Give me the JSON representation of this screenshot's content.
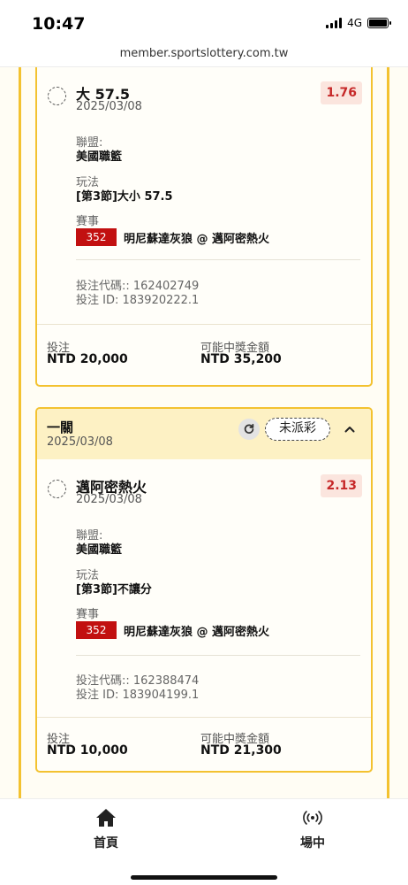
{
  "status_bar": {
    "time": "10:47",
    "network": "4G"
  },
  "browser": {
    "url": "member.sportslottery.com.tw"
  },
  "bets": [
    {
      "selection": "大 57.5",
      "selection_date": "2025/03/08",
      "odds": "1.76",
      "league_label": "聯盟:",
      "league": "美國職籃",
      "play_label": "玩法",
      "play": "[第3節]大小 57.5",
      "event_label": "賽事",
      "event_no": "352",
      "event_name": "明尼蘇達灰狼 @ 邁阿密熱火",
      "bet_code_line": "投注代碼:: 162402749",
      "bet_id_line": "投注 ID: 183920222.1",
      "stake_label": "投注",
      "stake": "NTD 20,000",
      "payout_label": "可能中獎金額",
      "payout": "NTD 35,200"
    },
    {
      "header_title": "一關",
      "header_date": "2025/03/08",
      "status": "未派彩",
      "selection": "邁阿密熱火",
      "selection_date": "2025/03/08",
      "odds": "2.13",
      "league_label": "聯盟:",
      "league": "美國職籃",
      "play_label": "玩法",
      "play": "[第3節]不讓分",
      "event_label": "賽事",
      "event_no": "352",
      "event_name": "明尼蘇達灰狼 @ 邁阿密熱火",
      "bet_code_line": "投注代碼:: 162388474",
      "bet_id_line": "投注 ID: 183904199.1",
      "stake_label": "投注",
      "stake": "NTD 10,000",
      "payout_label": "可能中獎金額",
      "payout": "NTD 21,300"
    }
  ],
  "bottom_nav": [
    {
      "label": "首頁",
      "icon": "home-icon"
    },
    {
      "label": "場中",
      "icon": "live-broadcast-icon"
    }
  ],
  "colors": {
    "accent": "#f3c230",
    "odds": "#c62828",
    "event_badge": "#c21010",
    "card_header": "#fdf1c4"
  }
}
